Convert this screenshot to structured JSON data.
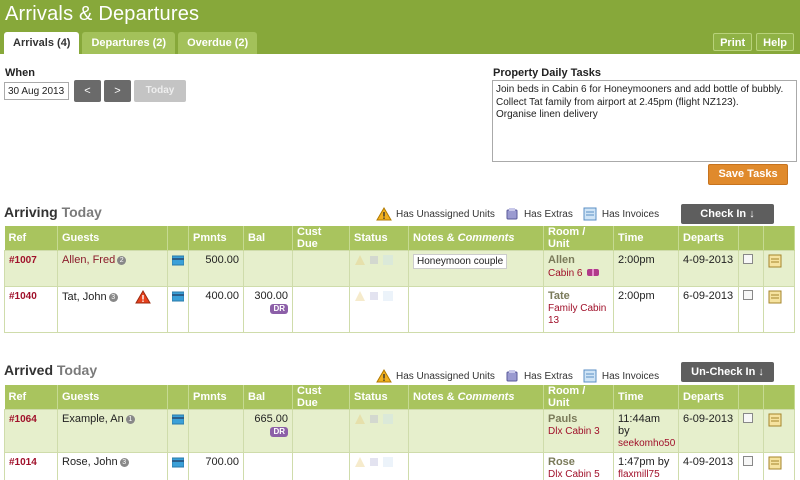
{
  "app": {
    "title": "Arrivals & Departures"
  },
  "tabs": [
    {
      "label": "Arrivals (4)",
      "active": true
    },
    {
      "label": "Departures (2)",
      "active": false
    },
    {
      "label": "Overdue (2)",
      "active": false
    }
  ],
  "header_buttons": {
    "print": "Print",
    "help": "Help"
  },
  "when": {
    "label": "When",
    "date": "30 Aug 2013",
    "prev": "<",
    "next": ">",
    "today": "Today"
  },
  "tasks": {
    "label": "Property Daily Tasks",
    "text": "Join beds in Cabin 6 for Honeymooners and add bottle of bubbly.\nCollect Tat family from airport at 2.45pm (flight NZ123).\nOrganise linen delivery",
    "save": "Save Tasks"
  },
  "legend": {
    "unassigned": "Has Unassigned Units",
    "extras": "Has Extras",
    "invoices": "Has Invoices"
  },
  "columns": {
    "ref": "Ref",
    "guests": "Guests",
    "pmnts": "Pmnts",
    "bal": "Bal",
    "cust_due": "Cust Due",
    "status": "Status",
    "notes": "Notes & ",
    "comments": "Comments",
    "room": "Room / Unit",
    "time": "Time",
    "departs": "Departs"
  },
  "arriving": {
    "title": "Arriving",
    "subtitle": "Today",
    "action": "Check In ↓",
    "rows": [
      {
        "ref": "#1007",
        "guest": "Allen, Fred",
        "badge": "2",
        "pmnts": "500.00",
        "bal": "",
        "dr": "",
        "note": "Honeymoon couple",
        "room_name": "Allen",
        "room_unit": "Cabin 6",
        "time": "2:00pm",
        "departs": "4-09-2013",
        "warning": false
      },
      {
        "ref": "#1040",
        "guest": "Tat, John",
        "badge": "3",
        "pmnts": "400.00",
        "bal": "300.00",
        "dr": "DR",
        "note": "",
        "room_name": "Tate",
        "room_unit": "Family Cabin 13",
        "time": "2:00pm",
        "departs": "6-09-2013",
        "warning": true
      }
    ]
  },
  "arrived": {
    "title": "Arrived",
    "subtitle": "Today",
    "action": "Un-Check In ↓",
    "rows": [
      {
        "ref": "#1064",
        "guest": "Example, An",
        "badge": "1",
        "pmnts": "",
        "bal": "665.00",
        "dr": "DR",
        "room_name": "Pauls",
        "room_unit": "Dlx Cabin 3",
        "time": "11:44am by",
        "user": "seekomho50",
        "departs": "6-09-2013"
      },
      {
        "ref": "#1014",
        "guest": "Rose, John",
        "badge": "3",
        "pmnts": "700.00",
        "bal": "",
        "dr": "",
        "room_name": "Rose",
        "room_unit": "Dlx Cabin 5",
        "time": "1:47pm by",
        "user": "flaxmill75",
        "departs": "4-09-2013"
      }
    ]
  }
}
